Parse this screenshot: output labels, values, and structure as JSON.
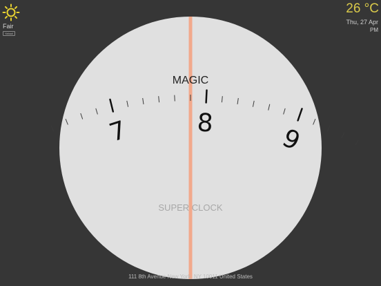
{
  "weather": {
    "icon": "sun-icon",
    "condition": "Fair",
    "provider": "Yahoo!"
  },
  "clock_header": {
    "temperature": "26 °C",
    "date": "Thu, 27 Apr",
    "meridiem": "PM"
  },
  "dial": {
    "top_label": "MAGIC",
    "bottom_label": "SUPER CLOCK",
    "hour_labels": [
      "7",
      "8",
      "9"
    ],
    "colors": {
      "face": "#e0e0e0",
      "indicator": "#f2a98c",
      "ticks": "#3a3a3a",
      "background": "#363636",
      "accent": "#d9c94a"
    }
  },
  "location": {
    "address": "111 8th Avenue New York, NY 10011 United States"
  }
}
